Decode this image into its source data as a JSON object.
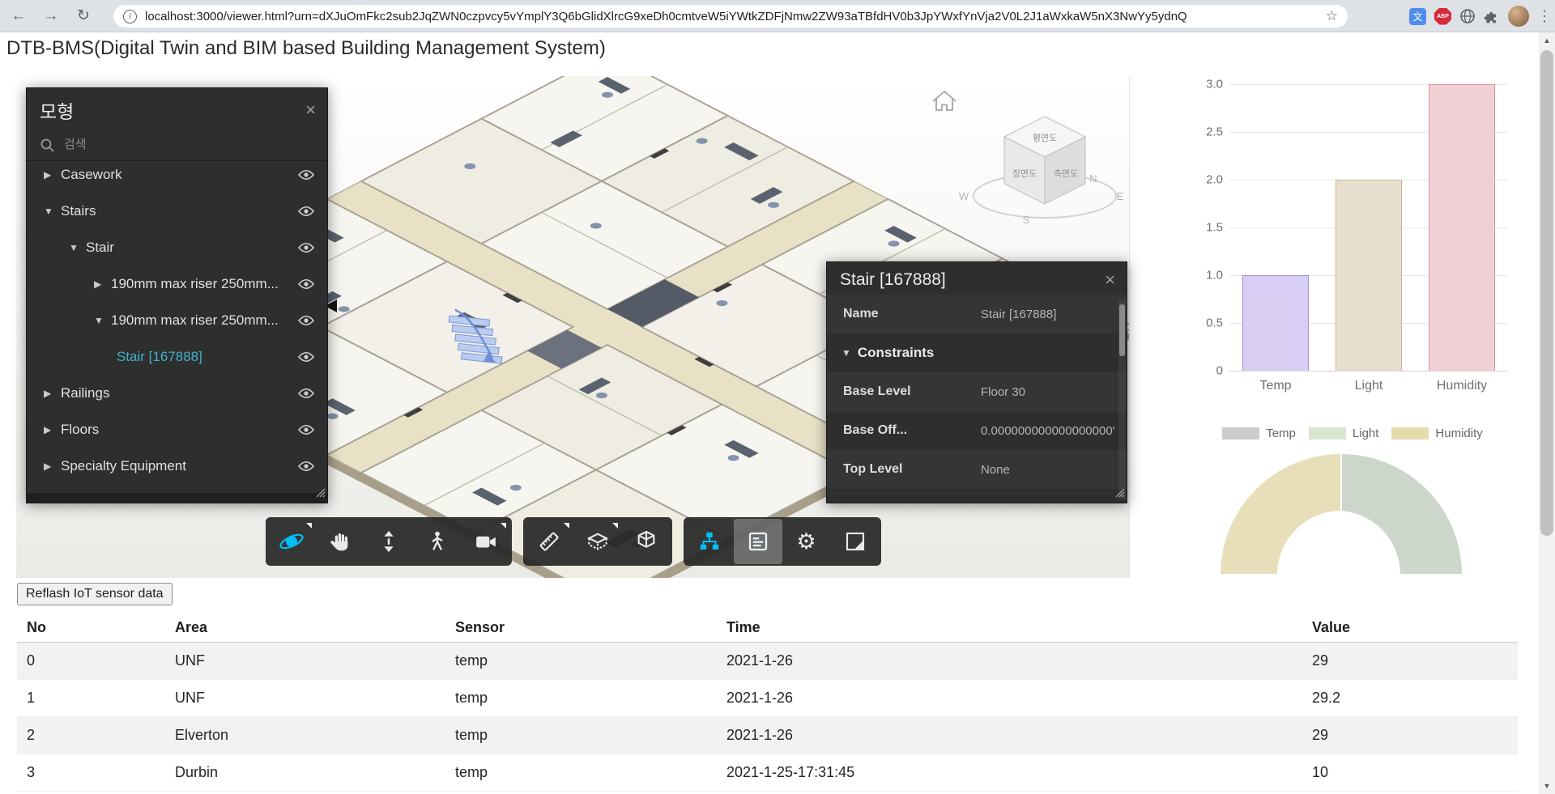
{
  "browser": {
    "url": "localhost:3000/viewer.html?urn=dXJuOmFkc2sub2JqZWN0czpvcy5vYmplY3Q6bGlidXlrcG9xeDh0cmtveW5iYWtkZDFjNmw2ZW93aTBfdHV0b3JpYWxfYnVja2V0L2J1aWxkaW5nX3NwYy5ydnQ",
    "icons": {
      "back": "←",
      "forward": "→",
      "reload": "↻",
      "info": "i",
      "star": "☆",
      "translate": "文",
      "abp": "ABP",
      "menu": "⋮"
    }
  },
  "page": {
    "title": "DTB-BMS(Digital Twin and BIM based Building Management System)"
  },
  "model_panel": {
    "title": "모형",
    "close": "×",
    "search_placeholder": "검색",
    "tree": [
      {
        "label": "Casework",
        "arrow": "▶",
        "level": 0,
        "selected": false
      },
      {
        "label": "Stairs",
        "arrow": "▼",
        "level": 0,
        "selected": false
      },
      {
        "label": "Stair",
        "arrow": "▼",
        "level": 1,
        "selected": false
      },
      {
        "label": "190mm max riser 250mm...",
        "arrow": "▶",
        "level": 2,
        "selected": false
      },
      {
        "label": "190mm max riser 250mm...",
        "arrow": "▼",
        "level": 2,
        "selected": false
      },
      {
        "label": "Stair [167888]",
        "arrow": "",
        "level": 3,
        "selected": true
      },
      {
        "label": "Railings",
        "arrow": "▶",
        "level": 0,
        "selected": false
      },
      {
        "label": "Floors",
        "arrow": "▶",
        "level": 0,
        "selected": false
      },
      {
        "label": "Specialty Equipment",
        "arrow": "▶",
        "level": 0,
        "selected": false
      }
    ]
  },
  "property_panel": {
    "title": "Stair [167888]",
    "close": "×",
    "category_arrow": "▼",
    "rows": [
      {
        "name": "Name",
        "value": "Stair [167888]"
      },
      {
        "name": "Constraints",
        "value": "",
        "is_category": true
      },
      {
        "name": "Base Level",
        "value": "Floor 30"
      },
      {
        "name": "Base Off...",
        "value": "0.000000000000000000'"
      },
      {
        "name": "Top Level",
        "value": "None"
      }
    ]
  },
  "viewcube": {
    "top": "평면도",
    "front": "정면도",
    "side": "측면도",
    "w": "W",
    "s": "S",
    "n": "N",
    "e": "E"
  },
  "toolbar": {
    "gear": "⚙",
    "tools": [
      "orbit",
      "pan",
      "zoom",
      "first-person",
      "camera",
      "measure",
      "section",
      "explode",
      "model-browser",
      "properties",
      "settings",
      "fullscreen"
    ],
    "active_color": "#00bfff"
  },
  "iot": {
    "refresh_button": "Reflash IoT sensor data",
    "columns": [
      "No",
      "Area",
      "Sensor",
      "Time",
      "Value"
    ],
    "rows": [
      [
        "0",
        "UNF",
        "temp",
        "2021-1-26",
        "29"
      ],
      [
        "1",
        "UNF",
        "temp",
        "2021-1-26",
        "29.2"
      ],
      [
        "2",
        "Elverton",
        "temp",
        "2021-1-26",
        "29"
      ],
      [
        "3",
        "Durbin",
        "temp",
        "2021-1-25-17:31:45",
        "10"
      ]
    ]
  },
  "scrollbar": {
    "up": "▲",
    "down": "▼"
  },
  "chart_data": [
    {
      "type": "bar",
      "categories": [
        "Temp",
        "Light",
        "Humidity"
      ],
      "values": [
        1.0,
        2.0,
        3.0
      ],
      "ylim": [
        0,
        3.0
      ],
      "yticks": [
        0,
        0.5,
        1.0,
        1.5,
        2.0,
        2.5,
        3.0
      ],
      "ytick_labels": [
        "3.0",
        "2.5",
        "2.0",
        "1.5",
        "1.0",
        "0.5",
        "0"
      ],
      "grid": true,
      "legend_position": "none",
      "bar_fills": [
        "#d8cdf2",
        "#e8decd",
        "#f0d0d5"
      ],
      "bar_borders": [
        "#9e90d8",
        "#cbb691",
        "#d795a1"
      ]
    },
    {
      "type": "pie",
      "variant": "half-doughnut",
      "legend_position": "top",
      "legend": [
        {
          "label": "Temp",
          "color": "#cccccc"
        },
        {
          "label": "Light",
          "color": "#d9e6d2"
        },
        {
          "label": "Humidity",
          "color": "#e4dcab"
        }
      ],
      "segments": [
        {
          "label": "left",
          "value": 1,
          "color": "#e6dfba"
        },
        {
          "label": "right",
          "value": 1,
          "color": "#cdd6ca"
        }
      ]
    }
  ]
}
